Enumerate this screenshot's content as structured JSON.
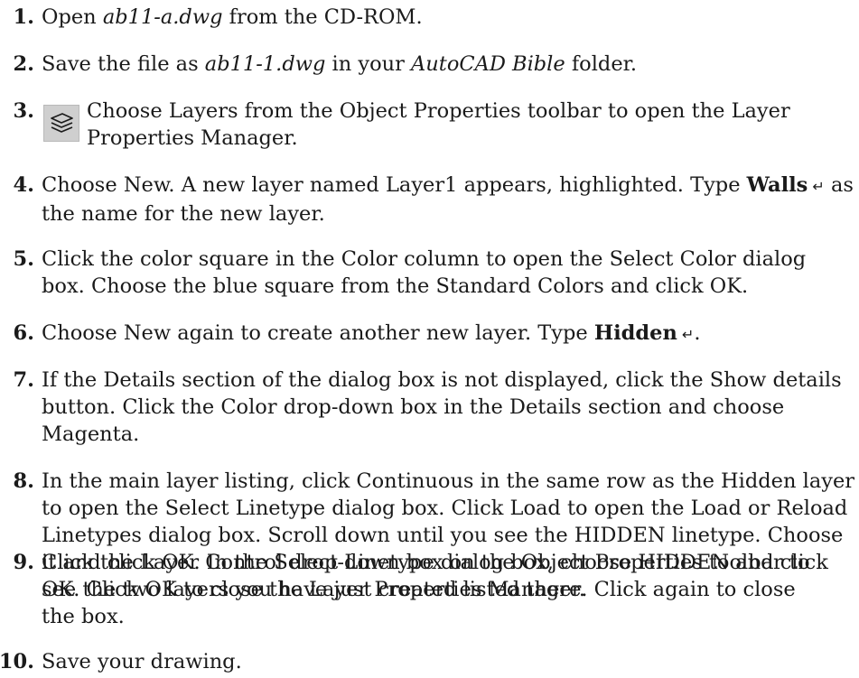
{
  "steps": [
    {
      "num": "1.",
      "parts": [
        {
          "t": "Open "
        },
        {
          "t": "ab11-a.dwg",
          "i": true
        },
        {
          "t": " from the CD-ROM."
        }
      ]
    },
    {
      "num": "2.",
      "parts": [
        {
          "t": "Save the file as "
        },
        {
          "t": "ab11-1.dwg",
          "i": true
        },
        {
          "t": " in your "
        },
        {
          "t": "AutoCAD Bible",
          "i": true
        },
        {
          "t": " folder."
        }
      ]
    },
    {
      "num": "3.",
      "icon": "layers-icon",
      "lines": [
        "Choose Layers from the Object Properties toolbar to open the Layer",
        "Properties Manager."
      ]
    },
    {
      "num": "4.",
      "line1": [
        {
          "t": "Choose New. A new layer named Layer1 appears, highlighted. Type "
        },
        {
          "t": "Walls",
          "b": true
        },
        {
          "t": " ↵",
          "k": true
        },
        {
          "t": " as"
        }
      ],
      "line2": "the name for the new layer."
    },
    {
      "num": "5.",
      "lines": [
        "Click the color square in the Color column to open the Select Color dialog",
        "box. Choose the blue square from the Standard Colors and click OK."
      ]
    },
    {
      "num": "6.",
      "parts": [
        {
          "t": "Choose New again to create another new layer. Type "
        },
        {
          "t": "Hidden",
          "b": true
        },
        {
          "t": " ↵",
          "k": true
        },
        {
          "t": "."
        }
      ]
    },
    {
      "num": "7.",
      "lines": [
        "If the Details section of the dialog box is not displayed, click the Show details",
        "button. Click the Color drop-down box in the Details section and choose",
        "Magenta."
      ]
    },
    {
      "num": "8.",
      "lines": [
        "In the main layer listing, click Continuous in the same row as the Hidden layer",
        "to open the Select Linetype dialog box. Click Load to open the Load or Reload",
        "Linetypes dialog box. Scroll down until you see the HIDDEN linetype. Choose",
        "it and click OK. In the Select Linetype dialog box, choose HIDDEN and click",
        "OK. Click OK to close the Layer Properties Manager."
      ]
    },
    {
      "num": "9.",
      "lines": [
        "Click the Layer Control drop-down box on the Object Properties toolbar to",
        "see the two layers you have just created listed there. Click again to close",
        "the box."
      ]
    },
    {
      "num": "10.",
      "lines": [
        "Save your drawing."
      ]
    }
  ]
}
